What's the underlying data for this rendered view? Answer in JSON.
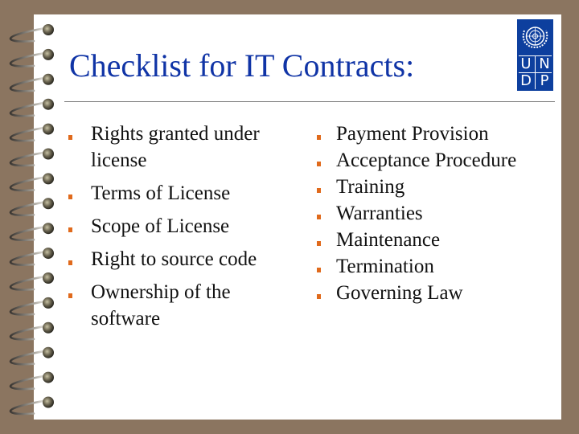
{
  "slide": {
    "title": "Checklist for IT Contracts:",
    "logo": {
      "name": "UNDP",
      "letters": [
        "U",
        "N",
        "D",
        "P"
      ],
      "color": "#0d3f9e"
    },
    "left_column": [
      "Rights granted under license",
      "Terms of License",
      "Scope of License",
      "Right to source code",
      "Ownership of the software"
    ],
    "right_column": [
      "Payment Provision",
      "Acceptance Procedure",
      "Training",
      "Warranties",
      "Maintenance",
      "Termination",
      "Governing Law"
    ],
    "colors": {
      "background": "#8b7560",
      "title": "#1034a6",
      "bullet": "#e06a1c"
    }
  }
}
